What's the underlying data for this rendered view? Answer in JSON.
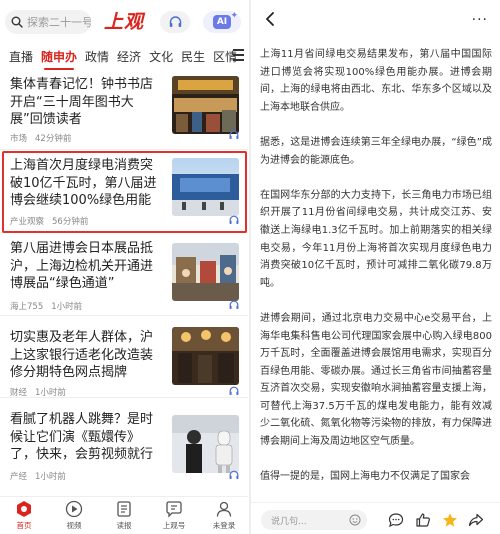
{
  "left": {
    "search": {
      "placeholder": "探索二十一号"
    },
    "logo": "上观",
    "tabs": [
      "直播",
      "随申办",
      "政情",
      "经济",
      "文化",
      "民生",
      "区情"
    ],
    "active_tab_index": 1,
    "articles": [
      {
        "title": "集体青春记忆！钟书书店开启“三十周年图书大展”回馈读者",
        "source": "市场",
        "time": "42分钟前"
      },
      {
        "title": "上海首次月度绿电消费突破10亿千瓦时，第八届进博会继续100%绿色用能",
        "source": "产业观察",
        "time": "56分钟前",
        "highlighted": true
      },
      {
        "title": "第八届进博会日本展品抵沪，上海边检机关开通进博展品“绿色通道”",
        "source": "海上755",
        "time": "1小时前"
      },
      {
        "title": "切实惠及老年人群体，沪上这家银行适老化改造装修分期特色网点揭牌",
        "source": "财经",
        "time": "1小时前"
      },
      {
        "title": "看腻了机器人跳舞？是时候让它们演《甄嬛传》了，快来，会剪视频就行",
        "source": "产经",
        "time": "1小时前"
      }
    ],
    "bottom_nav": [
      {
        "label": "首页",
        "icon": "home-icon",
        "active": true
      },
      {
        "label": "视频",
        "icon": "video-icon"
      },
      {
        "label": "读报",
        "icon": "newspaper-icon"
      },
      {
        "label": "上观号",
        "icon": "channel-icon"
      },
      {
        "label": "未登录",
        "icon": "user-icon"
      }
    ]
  },
  "right": {
    "paragraphs": [
      "上海11月省间绿电交易结果发布，第八届中国国际进口博览会将实现100%绿色用能办展。进博会期间，上海的绿电将由西北、东北、华东多个区域以及上海本地联合供应。",
      "据悉，这是进博会连续第三年全绿电办展，“绿色”成为进博会的能源底色。",
      "在国网华东分部的大力支持下，长三角电力市场已组织开展了11月份省间绿电交易，共计成交江苏、安徽送上海绿电1.3亿千瓦时。加上前期落实的相关绿电交易，今年11月份上海将首次实现月度绿色电力消费突破10亿千瓦时，预计可减排二氧化碳79.8万吨。",
      "进博会期间，通过北京电力交易中心e交易平台，上海华电集科售电公司代理国家会展中心购入绿电800万千瓦时，全面覆盖进博会展馆用电需求，实现百分百绿色用能、零碳办展。通过长三角省市间抽蓄容量互济首次交易，实现安徽响水涧抽蓄容量支援上海，可替代上海37.5万千瓦的煤电发电能力，能有效减少二氧化硫、氮氧化物等污染物的排放，有力保障进博会期间上海及周边地区空气质量。",
      "值得一提的是，国网上海电力不仅满足了国家会"
    ],
    "comment_placeholder": "说几句..."
  }
}
